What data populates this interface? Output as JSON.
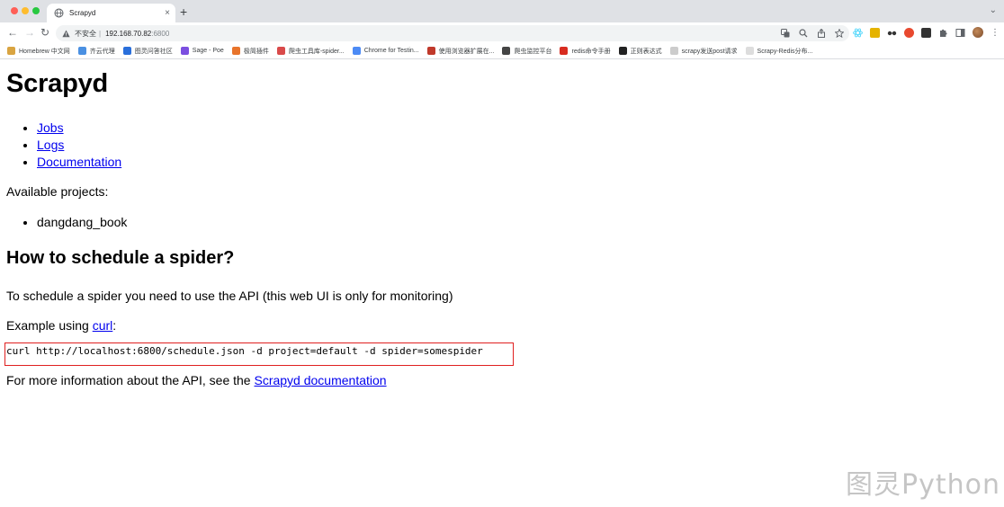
{
  "browser": {
    "tab": {
      "title": "Scrapyd",
      "close": "×"
    },
    "new_tab": "+",
    "tab_menu": "⌄",
    "nav": {
      "back": "←",
      "forward": "→",
      "reload": "↻"
    },
    "address": {
      "insecure_label": "不安全",
      "separator": "|",
      "host": "192.168.70.82",
      "port": ":6800"
    },
    "omnibox_icons": [
      "translate-icon",
      "zoom-icon",
      "share-icon",
      "bookmark-star-icon"
    ],
    "bookmarks": [
      {
        "label": "Homebrew 中文网",
        "icon_color": "#d9a441"
      },
      {
        "label": "齐云代理",
        "icon_color": "#4a90e2"
      },
      {
        "label": "图灵问答社区",
        "icon_color": "#2a6fdb"
      },
      {
        "label": "Sage - Poe",
        "icon_color": "#7b4fe0"
      },
      {
        "label": "极简插件",
        "icon_color": "#e8742b"
      },
      {
        "label": "爬虫工具库-spider...",
        "icon_color": "#d94a4a"
      },
      {
        "label": "Chrome for Testin...",
        "icon_color": "#4c8bf5"
      },
      {
        "label": "使用浏览器扩展在...",
        "icon_color": "#c0392b"
      },
      {
        "label": "爬虫监控平台",
        "icon_color": "#444444"
      },
      {
        "label": "redis命令手册",
        "icon_color": "#d82c20"
      },
      {
        "label": "正则表达式",
        "icon_color": "#222222"
      },
      {
        "label": "scrapy发送post请求",
        "icon_color": "#cccccc"
      },
      {
        "label": "Scrapy-Redis分布...",
        "icon_color": "#dddddd"
      }
    ]
  },
  "page": {
    "title": "Scrapyd",
    "nav_links": [
      "Jobs",
      "Logs",
      "Documentation"
    ],
    "available_label": "Available projects:",
    "projects": [
      "dangdang_book"
    ],
    "schedule_heading": "How to schedule a spider?",
    "schedule_text": "To schedule a spider you need to use the API (this web UI is only for monitoring)",
    "example_prefix": "Example using ",
    "example_link": "curl",
    "example_suffix": ":",
    "code": "curl http://localhost:6800/schedule.json -d project=default -d spider=somespider",
    "info_prefix": "For more information about the API, see the ",
    "info_link": "Scrapyd documentation"
  },
  "watermark": "图灵Python",
  "colors": {
    "link": "#0000ee",
    "highlight": "#e02020",
    "tabbar": "#dfe1e5"
  }
}
